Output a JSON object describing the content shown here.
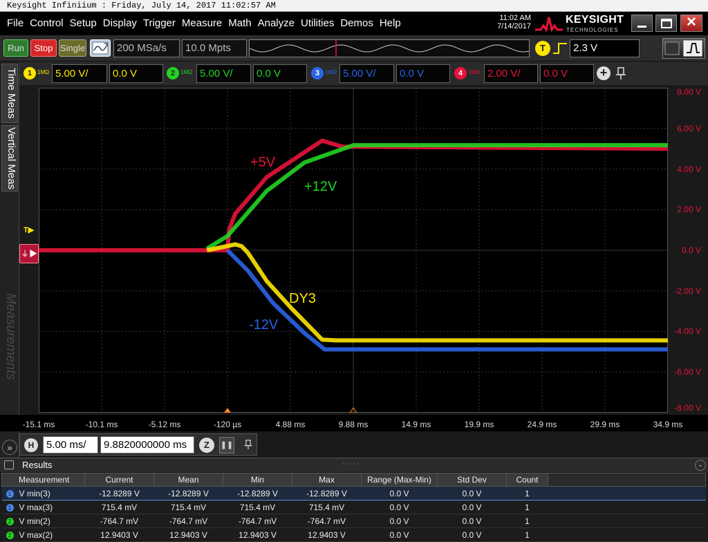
{
  "window": {
    "title": "Keysight Infiniium : Friday, July 14, 2017 11:02:57 AM",
    "time": "11:02 AM",
    "date": "7/14/2017",
    "brand": "KEYSIGHT",
    "brand_sub": "TECHNOLOGIES"
  },
  "menu": [
    "File",
    "Control",
    "Setup",
    "Display",
    "Trigger",
    "Measure",
    "Math",
    "Analyze",
    "Utilities",
    "Demos",
    "Help"
  ],
  "toolbar": {
    "run": "Run",
    "stop": "Stop",
    "single": "Single",
    "sample_rate": "200 MSa/s",
    "memory_depth": "10.0 Mpts",
    "trigger_badge": "T",
    "trigger_level": "2.3 V"
  },
  "channels": [
    {
      "num": "1",
      "coupling": "1MΩ",
      "scale": "5.00 V/",
      "offset": "0.0 V",
      "color": "#ffe600"
    },
    {
      "num": "2",
      "coupling": "1MΩ",
      "scale": "5.00 V/",
      "offset": "0.0 V",
      "color": "#22d422"
    },
    {
      "num": "3",
      "coupling": "1MΩ",
      "scale": "5.00 V/",
      "offset": "0.0 V",
      "color": "#2a64e6"
    },
    {
      "num": "4",
      "coupling": "1MΩ",
      "scale": "2.00 V/",
      "offset": "0.0 V",
      "color": "#e8143a"
    }
  ],
  "sidebar": {
    "tabs": [
      "Time Meas",
      "Vertical Meas"
    ],
    "measurements_watermark": "Measurements"
  },
  "markers": {
    "trigger": "T",
    "expander": "»"
  },
  "horizontal": {
    "badge": "H",
    "scale": "5.00 ms/",
    "position": "9.8820000000 ms",
    "zoom_badge": "Z"
  },
  "chart_data": {
    "type": "line",
    "x_ticks": [
      "-15.1 ms",
      "-10.1 ms",
      "-5.12 ms",
      "-120 µs",
      "4.88 ms",
      "9.88 ms",
      "14.9 ms",
      "19.9 ms",
      "24.9 ms",
      "29.9 ms",
      "34.9 ms"
    ],
    "y_ticks": [
      "8.00 V",
      "6.00 V",
      "4.00 V",
      "2.00 V",
      "0.0 V",
      "-2.00 V",
      "-4.00 V",
      "-6.00 V",
      "-8.00 V"
    ],
    "xlim_ms": [
      -15.12,
      34.88
    ],
    "ylim_div": [
      -4,
      4
    ],
    "grid": true,
    "annotations": [
      "+5V",
      "+12V",
      "DY3",
      "-12V"
    ],
    "series": [
      {
        "name": "+5V",
        "channel": "4",
        "color": "#e8143a",
        "points_ms_v": [
          [
            -15.12,
            0.0
          ],
          [
            -0.12,
            0.0
          ],
          [
            0.0,
            1.0
          ],
          [
            0.5,
            1.8
          ],
          [
            3.0,
            3.6
          ],
          [
            7.4,
            5.4
          ],
          [
            9.0,
            5.1
          ],
          [
            34.88,
            5.0
          ]
        ]
      },
      {
        "name": "+12V",
        "channel": "2",
        "color": "#22d422",
        "points_ms_v": [
          [
            -1.75,
            0.2
          ],
          [
            -0.12,
            1.75
          ],
          [
            3.0,
            7.3
          ],
          [
            6.0,
            10.8
          ],
          [
            9.9,
            12.94
          ],
          [
            34.88,
            12.94
          ]
        ]
      },
      {
        "name": "DY3",
        "channel": "1",
        "color": "#ffe600",
        "points_ms_v": [
          [
            -1.75,
            0.0
          ],
          [
            0.5,
            0.72
          ],
          [
            1.0,
            0.5
          ],
          [
            1.5,
            -0.3
          ],
          [
            3.0,
            -3.8
          ],
          [
            5.0,
            -7.2
          ],
          [
            7.4,
            -11.0
          ],
          [
            8.5,
            -11.1
          ],
          [
            34.88,
            -11.1
          ]
        ]
      },
      {
        "name": "-12V",
        "channel": "3",
        "color": "#2a64e6",
        "points_ms_v": [
          [
            -0.12,
            0.0
          ],
          [
            1.5,
            -2.5
          ],
          [
            3.5,
            -6.5
          ],
          [
            6.0,
            -10.2
          ],
          [
            7.6,
            -12.2
          ],
          [
            34.88,
            -12.2
          ]
        ]
      }
    ]
  },
  "results": {
    "title": "Results",
    "dots": "·····",
    "columns": [
      "Measurement",
      "Current",
      "Mean",
      "Min",
      "Max",
      "Range (Max-Min)",
      "Std Dev",
      "Count"
    ],
    "rows": [
      {
        "badge": "1",
        "color": "#4a86e8",
        "name": "V min(3)",
        "values": [
          "-12.8289 V",
          "-12.8289 V",
          "-12.8289 V",
          "-12.8289 V",
          "0.0 V",
          "0.0 V",
          "1"
        ]
      },
      {
        "badge": "1",
        "color": "#4a86e8",
        "name": "V max(3)",
        "values": [
          "715.4 mV",
          "715.4 mV",
          "715.4 mV",
          "715.4 mV",
          "0.0 V",
          "0.0 V",
          "1"
        ]
      },
      {
        "badge": "2",
        "color": "#22d422",
        "name": "V min(2)",
        "values": [
          "-764.7 mV",
          "-764.7 mV",
          "-764.7 mV",
          "-764.7 mV",
          "0.0 V",
          "0.0 V",
          "1"
        ]
      },
      {
        "badge": "2",
        "color": "#22d422",
        "name": "V max(2)",
        "values": [
          "12.9403 V",
          "12.9403 V",
          "12.9403 V",
          "12.9403 V",
          "0.0 V",
          "0.0 V",
          "1"
        ]
      }
    ]
  }
}
